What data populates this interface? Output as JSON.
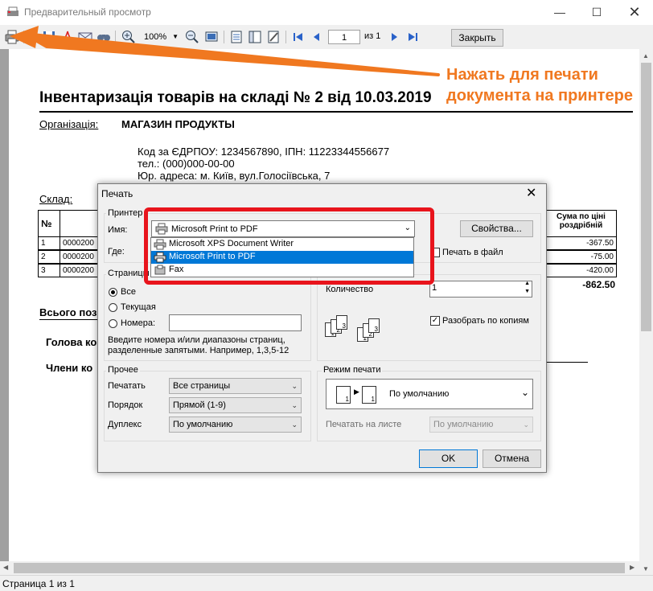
{
  "window": {
    "title": "Предварительный просмотр"
  },
  "toolbar": {
    "zoom": "100%",
    "page": "1",
    "of_label": "из 1",
    "close_label": "Закрыть"
  },
  "annotation": {
    "line1": "Нажать для печати",
    "line2": "документа на принтере",
    "color": "#f07820"
  },
  "document": {
    "title": "Інвентаризація товарів на складі № 2 від 10.03.2019",
    "org_label": "Організація:",
    "org_name": "МАГАЗИН ПРОДУКТЫ",
    "code_line": "Код за ЄДРПОУ: 1234567890, ІПН: 11223344556677",
    "phone_line": "тел.: (000)000-00-00",
    "address_line": "Юр. адреса: м. Київ, вул.Голосіївська, 7",
    "warehouse_label": "Склад:",
    "table": {
      "header_no": "№",
      "header_sum": "Сума по ціні роздрібній",
      "rows": [
        {
          "n": "1",
          "code": "0000200",
          "sum": "-367.50"
        },
        {
          "n": "2",
          "code": "0000200",
          "sum": "-75.00"
        },
        {
          "n": "3",
          "code": "0000200",
          "sum": "-420.00"
        }
      ],
      "total": "-862.50"
    },
    "total_label": "Всього поз",
    "head_label": "Голова ко",
    "members_label": "Члени ко"
  },
  "dialog": {
    "title": "Печать",
    "printer_group": "Принтер",
    "name_label": "Имя:",
    "where_label": "Где:",
    "selected_printer": "Microsoft Print to PDF",
    "printer_options": [
      "Microsoft XPS Document Writer",
      "Microsoft Print to PDF",
      "Fax"
    ],
    "properties_label": "Свойства...",
    "print_to_file_label": "Печать в файл",
    "pages_group": "Страницы",
    "all_label": "Все",
    "current_label": "Текущая",
    "numbers_label": "Номера:",
    "pages_hint": "Введите номера и/или диапазоны страниц, разделенные запятыми. Например, 1,3,5-12",
    "copies_label": "Количество",
    "copies_value": "1",
    "collate_label": "Разобрать по копиям",
    "other_group": "Прочее",
    "print_label": "Печатать",
    "print_value": "Все страницы",
    "order_label": "Порядок",
    "order_value": "Прямой (1-9)",
    "duplex_label": "Дуплекс",
    "duplex_value": "По умолчанию",
    "mode_group": "Режим печати",
    "mode_value": "По умолчанию",
    "print_on_sheet_label": "Печатать на листе",
    "print_on_sheet_value": "По умолчанию",
    "ok_label": "OK",
    "cancel_label": "Отмена"
  },
  "status": {
    "text": "Страница 1 из 1"
  },
  "colors": {
    "highlight_box": "#e8141c",
    "selection": "#0078d7",
    "annotation": "#f07820"
  }
}
